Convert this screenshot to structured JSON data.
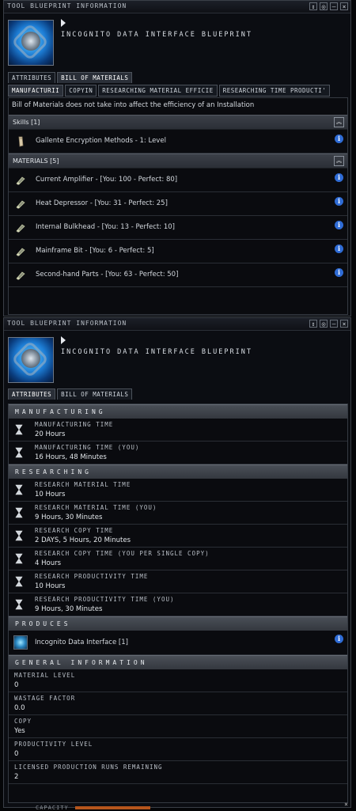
{
  "window1": {
    "title": "TOOL BLUEPRINT INFORMATION",
    "controls": [
      "↕",
      "◎",
      "—",
      "×"
    ],
    "blueprint_name": "INCOGNITO DATA INTERFACE BLUEPRINT",
    "tabs": [
      {
        "label": "ATTRIBUTES"
      },
      {
        "label": "BILL OF MATERIALS"
      }
    ],
    "subtabs": [
      {
        "label": "MANUFACTURII"
      },
      {
        "label": "COPYIN"
      },
      {
        "label": "RESEARCHING MATERIAL EFFICIE"
      },
      {
        "label": "RESEARCHING TIME PRODUCTI'"
      }
    ],
    "note": "Bill of Materials does not take into affect the efficiency of an Installation",
    "skills_header": "Skills [1]",
    "skills": [
      {
        "label": "Gallente Encryption Methods - 1: Level"
      }
    ],
    "materials_header": "MATERIALS [5]",
    "materials": [
      {
        "label": "Current Amplifier - [You: 100 - Perfect: 80]"
      },
      {
        "label": "Heat Depressor - [You: 31 - Perfect: 25]"
      },
      {
        "label": "Internal Bulkhead - [You: 13 - Perfect: 10]"
      },
      {
        "label": "Mainframe Bit - [You: 6 - Perfect: 5]"
      },
      {
        "label": "Second-hand Parts - [You: 63 - Perfect: 50]"
      }
    ],
    "collapse_glyph": "︽",
    "info_glyph": "i"
  },
  "window2": {
    "title": "TOOL BLUEPRINT INFORMATION",
    "controls": [
      "↕",
      "◎",
      "—",
      "×"
    ],
    "blueprint_name": "INCOGNITO DATA INTERFACE BLUEPRINT",
    "tabs": [
      {
        "label": "ATTRIBUTES"
      },
      {
        "label": "BILL OF MATERIALS"
      }
    ],
    "manufacturing_header": "MANUFACTURING",
    "manufacturing": [
      {
        "key": "MANUFACTURING TIME",
        "value": "20 Hours"
      },
      {
        "key": "MANUFACTURING TIME (YOU)",
        "value": "16 Hours, 48 Minutes"
      }
    ],
    "researching_header": "RESEARCHING",
    "researching": [
      {
        "key": "RESEARCH MATERIAL TIME",
        "value": "10 Hours"
      },
      {
        "key": "RESEARCH MATERIAL TIME (YOU)",
        "value": "9 Hours, 30 Minutes"
      },
      {
        "key": "RESEARCH COPY TIME",
        "value": "2 DAYS, 5 Hours, 20 Minutes"
      },
      {
        "key": "RESEARCH COPY TIME (YOU PER SINGLE COPY)",
        "value": "4 Hours"
      },
      {
        "key": "RESEARCH PRODUCTIVITY TIME",
        "value": "10 Hours"
      },
      {
        "key": "RESEARCH PRODUCTIVITY TIME (YOU)",
        "value": "9 Hours, 30 Minutes"
      }
    ],
    "produces_header": "PRODUCES",
    "produces": {
      "label": "Incognito Data Interface [1]"
    },
    "general_header": "GENERAL INFORMATION",
    "general": [
      {
        "key": "MATERIAL LEVEL",
        "value": "0"
      },
      {
        "key": "WASTAGE FACTOR",
        "value": "0.0"
      },
      {
        "key": "COPY",
        "value": "Yes"
      },
      {
        "key": "PRODUCTIVITY LEVEL",
        "value": "0"
      },
      {
        "key": "LICENSED PRODUCTION RUNS REMAINING",
        "value": "2"
      }
    ],
    "info_glyph": "i"
  },
  "footer": {
    "capacity_label": "CAPACITY",
    "close_glyph": "×"
  },
  "colors": {
    "accent": "#2f6cd6",
    "section_bg": "#3b4048",
    "capacity_fill": "#b5551c"
  }
}
